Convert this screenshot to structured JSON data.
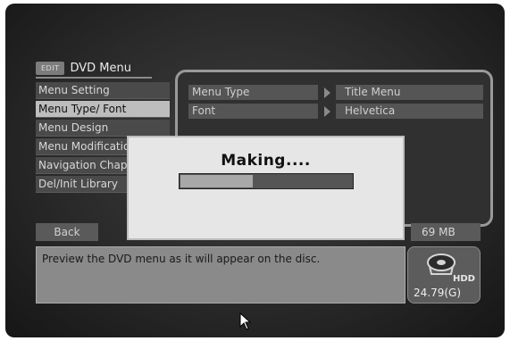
{
  "header": {
    "badge": "EDIT",
    "title": "DVD Menu"
  },
  "sidebar": {
    "items": [
      {
        "label": "Menu Setting",
        "selected": false
      },
      {
        "label": "Menu Type/ Font",
        "selected": true
      },
      {
        "label": "Menu Design",
        "selected": false
      },
      {
        "label": "Menu Modification",
        "selected": false
      },
      {
        "label": "Navigation Chapter",
        "selected": false
      },
      {
        "label": "Del/Init Library",
        "selected": false
      }
    ]
  },
  "details": {
    "rows": [
      {
        "key": "Menu Type",
        "value": "Title Menu"
      },
      {
        "key": "Font",
        "value": "Helvetica"
      }
    ]
  },
  "bottom": {
    "back_label": "Back",
    "size_label": "69 MB"
  },
  "description": "Preview the DVD menu as it will appear on the disc.",
  "hdd": {
    "label": "HDD",
    "capacity": "24.79(G)",
    "icon": "hdd-icon"
  },
  "dialog": {
    "title": "Making....",
    "progress": 0.42
  },
  "colors": {
    "accent": "#bdbdbd",
    "background": "#2a2a2a"
  }
}
